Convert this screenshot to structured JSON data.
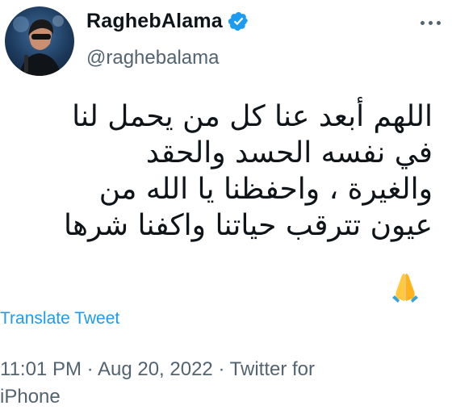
{
  "author": {
    "display_name": "RaghebAlama",
    "handle": "@raghebalama",
    "verified": true
  },
  "tweet": {
    "text": "اللهم أبعد عنا كل من يحمل لنا\nفي نفسه الحسد والحقد\nوالغيرة ، واحفظنا يا الله من\nعيون تترقب حياتنا واكفنا شرها",
    "emoji": "folded-hands",
    "translate_label": "Translate Tweet"
  },
  "meta": {
    "time": "11:01 PM",
    "separator": "·",
    "date": "Aug 20, 2022",
    "source": "Twitter for iPhone"
  },
  "colors": {
    "accent": "#1d9bf0",
    "secondary_text": "#536471",
    "primary_text": "#0f1419"
  }
}
